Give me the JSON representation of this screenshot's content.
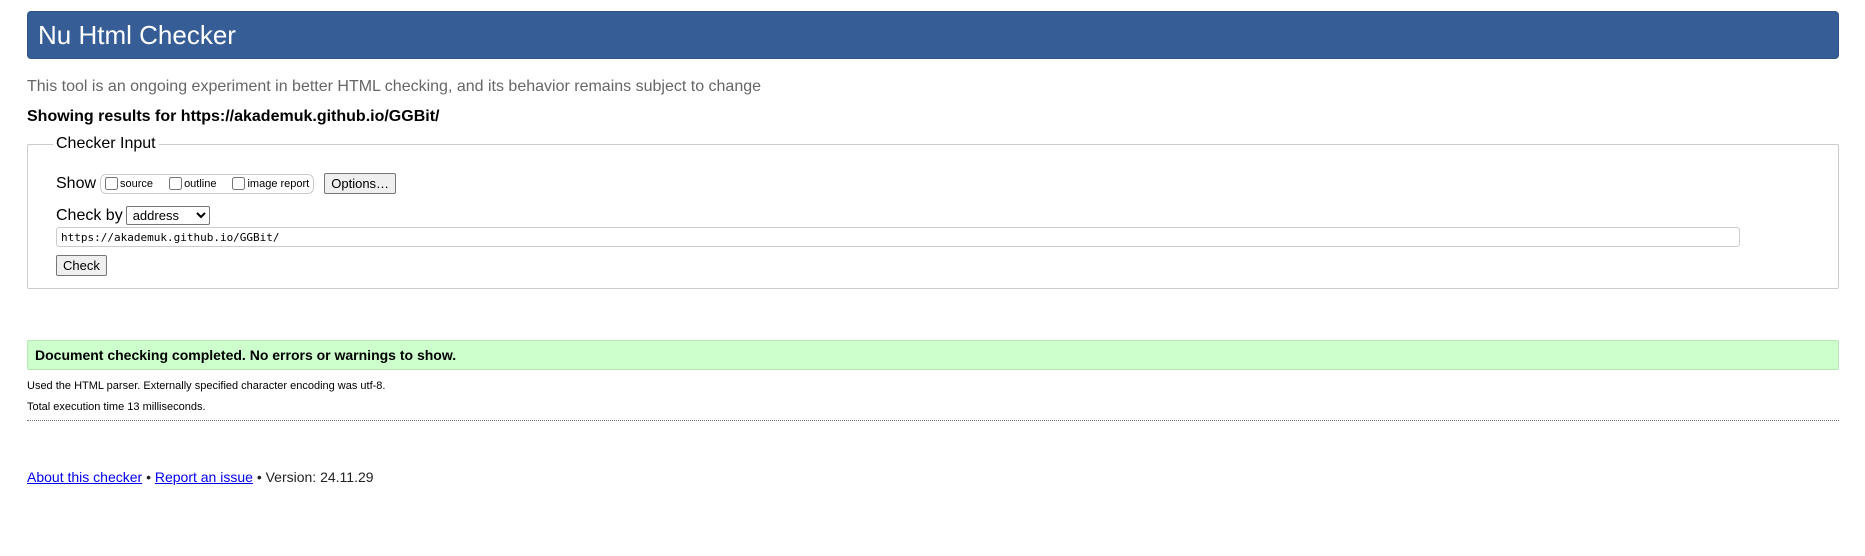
{
  "header": {
    "title": "Nu Html Checker"
  },
  "subtitle": "This tool is an ongoing experiment in better HTML checking, and its behavior remains subject to change",
  "results_for": "Showing results for https://akademuk.github.io/GGBit/",
  "checker_input": {
    "legend": "Checker Input",
    "show_label": "Show",
    "show_options": [
      {
        "label": "source",
        "checked": false
      },
      {
        "label": "outline",
        "checked": false
      },
      {
        "label": "image report",
        "checked": false
      }
    ],
    "options_button": "Options…",
    "check_by_label": "Check by",
    "check_by_selected": "address",
    "url_value": "https://akademuk.github.io/GGBit/",
    "check_button": "Check"
  },
  "result": {
    "message": "Document checking completed. No errors or warnings to show.",
    "details": [
      "Used the HTML parser. Externally specified character encoding was utf-8.",
      "Total execution time 13 milliseconds."
    ]
  },
  "footer": {
    "about_link": "About this checker",
    "separator": "•",
    "report_link": "Report an issue",
    "version": "Version: 24.11.29"
  },
  "colors": {
    "header_bg": "#365d95",
    "success_bg": "#ccffcc",
    "link": "#0000ee"
  }
}
